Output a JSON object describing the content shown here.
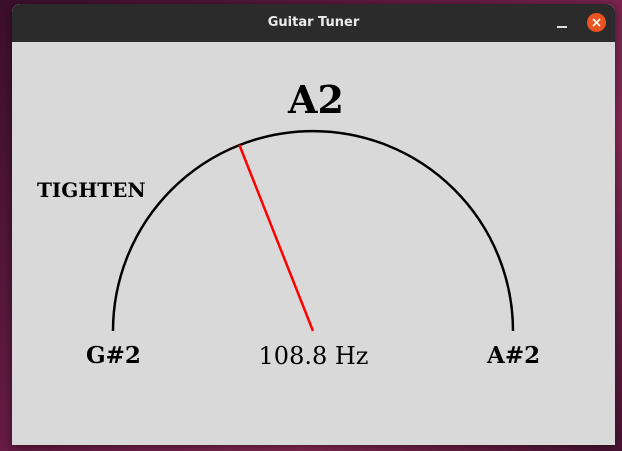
{
  "window": {
    "title": "Guitar Tuner"
  },
  "tuner": {
    "note": "A2",
    "instruction": "TIGHTEN",
    "lower_note": "G#2",
    "upper_note": "A#2",
    "frequency_text": "108.8 Hz",
    "needle_fraction": 0.38,
    "needle_color": "#ff0000",
    "arc_color": "#000000"
  },
  "colors": {
    "window_bg": "#d9d9d9",
    "titlebar_bg": "#2b2b2b",
    "close_button": "#e95420"
  },
  "icons": {
    "minimize": "minimize-icon",
    "close": "close-icon"
  }
}
